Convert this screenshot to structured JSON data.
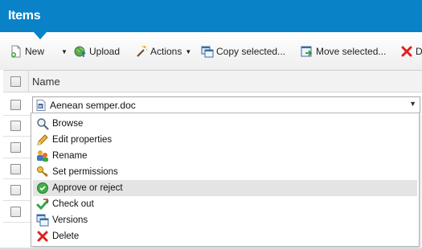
{
  "header": {
    "title": "Items"
  },
  "toolbar": {
    "new_label": "New",
    "upload_label": "Upload",
    "actions_label": "Actions",
    "copy_label": "Copy selected...",
    "move_label": "Move selected...",
    "delete_label": "De"
  },
  "grid": {
    "column_name": "Name",
    "row_count": 6
  },
  "dropdown": {
    "selected_value": "Aenean semper.doc",
    "items": [
      {
        "label": "Browse",
        "icon": "magnifier-icon"
      },
      {
        "label": "Edit properties",
        "icon": "pencil-icon"
      },
      {
        "label": "Rename",
        "icon": "rename-icon"
      },
      {
        "label": "Set permissions",
        "icon": "key-icon"
      },
      {
        "label": "Approve or reject",
        "icon": "approve-icon",
        "highlighted": true
      },
      {
        "label": "Check out",
        "icon": "checkout-icon"
      },
      {
        "label": "Versions",
        "icon": "versions-icon"
      },
      {
        "label": "Delete",
        "icon": "delete-x-icon"
      }
    ]
  },
  "colors": {
    "header": "#0a82c8",
    "highlight": "#e4e4e4"
  }
}
